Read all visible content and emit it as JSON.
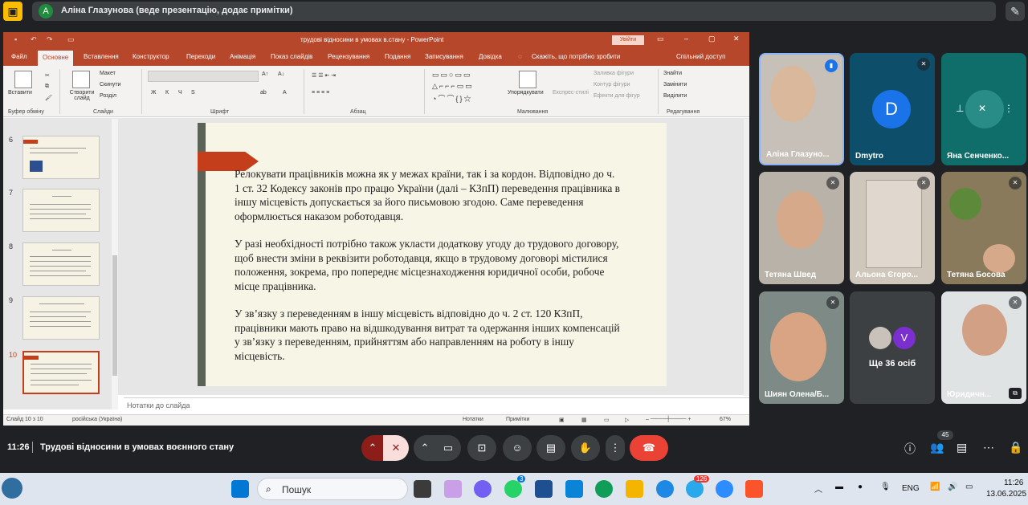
{
  "meet": {
    "presenter_avatar": "A",
    "presenter_banner": "Аліна Глазунова (веде презентацію, додає примітки)",
    "time": "11:26",
    "title": "Трудові відносини в умовах воєнного стану",
    "people_badge": "45"
  },
  "ppt": {
    "window_title": "трудові відносини в умовах в.стану  -  PowerPoint",
    "login_label": "Увійти",
    "tabs": [
      "Файл",
      "Основне",
      "Вставлення",
      "Конструктор",
      "Переходи",
      "Анімація",
      "Показ слайдів",
      "Рецензування",
      "Подання",
      "Записування",
      "Довідка"
    ],
    "tell_me": "Скажіть, що потрібно зробити",
    "share": "Спільний доступ",
    "ribbon": {
      "paste": "Вставити",
      "clipboard": "Буфер обміну",
      "new_slide": "Створити слайд",
      "layout": "Макет",
      "reset": "Скинути",
      "section": "Розділ",
      "slides": "Слайди",
      "font": "Шрифт",
      "paragraph": "Абзац",
      "drawing": "Малювання",
      "arrange": "Упорядкувати",
      "quick_styles": "Експрес-стилі",
      "shape_fill": "Заливка фігури",
      "shape_outline": "Контур фігури",
      "shape_effects": "Ефекти для фігур",
      "find": "Знайти",
      "replace": "Замінити",
      "select": "Виділити",
      "editing": "Редагування"
    },
    "thumbnails": [
      "6",
      "7",
      "8",
      "9",
      "10"
    ],
    "slide_paragraphs": [
      "Релокувати працівників можна як у межах країни, так і за кордон. Відповідно до ч. 1 ст. 32 Кодексу законів про працю України (далі – КЗпП) переведення працівника в іншу місцевість допускається за його письмовою згодою. Саме переведення оформлюється наказом роботодавця.",
      "У разі необхідності потрібно також укласти додаткову угоду до трудового договору, щоб внести зміни в реквізити роботодавця, якщо в трудовому договорі містилися положення, зокрема, про попереднє місцезнаходження юридичної особи, робоче місце працівника.",
      "У зв’язку з переведенням в іншу місцевість відповідно до ч. 2 ст. 120 КЗпП, працівники мають право на відшкодування витрат та одержання інших компенсацій у зв’язку з переведенням, прийняттям або направленням на роботу в іншу місцевість."
    ],
    "notes_placeholder": "Нотатки до слайда",
    "status": {
      "slide": "Слайд 10 з 10",
      "language": "російська (Україна)",
      "notes": "Нотатки",
      "comments": "Примітки",
      "zoom": "67%"
    }
  },
  "participants": [
    {
      "name": "Аліна Глазуно...",
      "speaking": true
    },
    {
      "name": "Dmytro",
      "initial": "D"
    },
    {
      "name": "Яна Сенченко..."
    },
    {
      "name": "Тетяна Швед"
    },
    {
      "name": "Альона Єгоро..."
    },
    {
      "name": "Тетяна Босова"
    },
    {
      "name": "Шиян Олена/Б..."
    },
    {
      "name": "Ще 36 осіб",
      "initial": "V"
    },
    {
      "name": "Юридичн..."
    }
  ],
  "taskbar": {
    "search_placeholder": "Пошук",
    "language": "ENG",
    "time": "11:26",
    "date": "13.06.2025",
    "badge_whatsapp": "3",
    "badge_telegram": "126"
  },
  "colors": {
    "ppt_accent": "#b7472a",
    "slide_arrow": "#c43e1c",
    "meet_bg": "#202124",
    "leave_red": "#ea4335"
  }
}
